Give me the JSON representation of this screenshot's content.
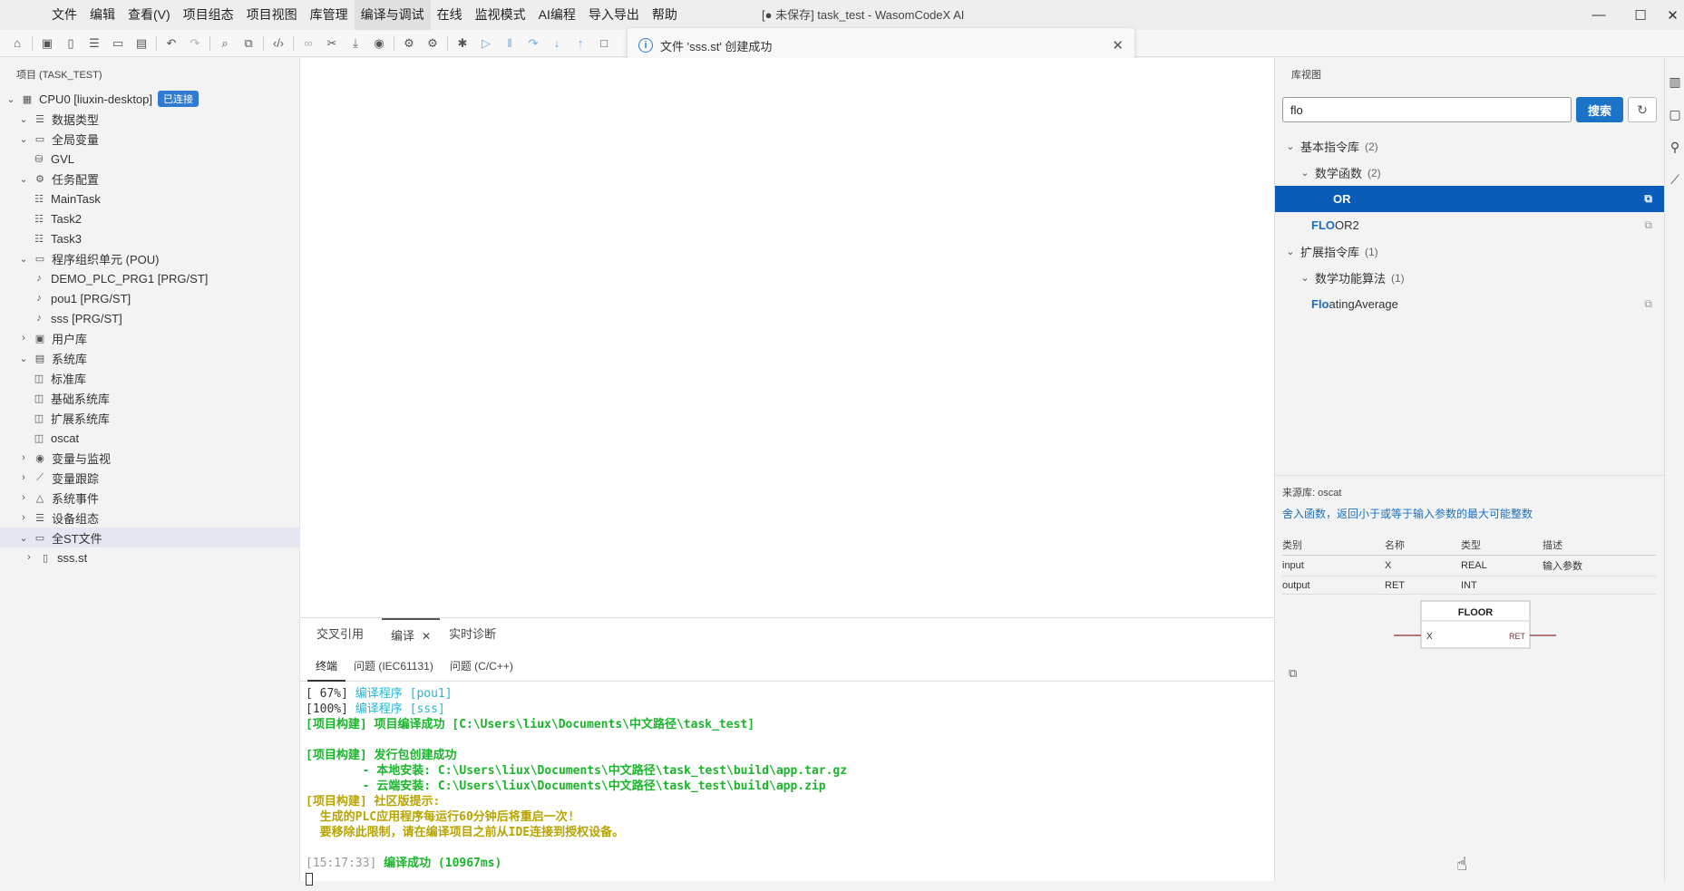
{
  "menu": [
    "文件",
    "编辑",
    "查看(V)",
    "项目组态",
    "项目视图",
    "库管理",
    "编译与调试",
    "在线",
    "监视模式",
    "AI编程",
    "导入导出",
    "帮助"
  ],
  "window_title": "[● 未保存] task_test - WasomCodeX AI",
  "toast": {
    "message": "文件 'sss.st' 创建成功"
  },
  "project_panel": {
    "title": "项目 (TASK_TEST)",
    "cpu": {
      "label": "CPU0 [liuxin-desktop]",
      "badge": "已连接"
    },
    "items": [
      {
        "label": "数据类型"
      },
      {
        "label": "全局变量"
      },
      {
        "label": "GVL"
      },
      {
        "label": "任务配置"
      },
      {
        "label": "MainTask"
      },
      {
        "label": "Task2"
      },
      {
        "label": "Task3"
      },
      {
        "label": "程序组织单元 (POU)"
      },
      {
        "label": "DEMO_PLC_PRG1 [PRG/ST]"
      },
      {
        "label": "pou1 [PRG/ST]"
      },
      {
        "label": "sss [PRG/ST]"
      },
      {
        "label": "用户库"
      },
      {
        "label": "系统库"
      },
      {
        "label": "标准库"
      },
      {
        "label": "基础系统库"
      },
      {
        "label": "扩展系统库"
      },
      {
        "label": "oscat"
      },
      {
        "label": "变量与监视"
      },
      {
        "label": "变量跟踪"
      },
      {
        "label": "系统事件"
      },
      {
        "label": "设备组态"
      },
      {
        "label": "全ST文件"
      },
      {
        "label": "sss.st"
      }
    ]
  },
  "bottom_panel": {
    "tabs": [
      "交叉引用",
      "编译",
      "实时诊断"
    ],
    "subtabs": [
      "终端",
      "问题 (IEC61131)",
      "问题 (C/C++)"
    ],
    "terminal": {
      "l1a": "[ 67%] ",
      "l1b": "编译程序 [pou1]",
      "l2a": "[100%] ",
      "l2b": "编译程序 [sss]",
      "l3": "[项目构建] 项目编译成功 [C:\\Users\\liux\\Documents\\中文路径\\task_test]",
      "l5": "[项目构建] 发行包创建成功",
      "l6": "        - 本地安装: C:\\Users\\liux\\Documents\\中文路径\\task_test\\build\\app.tar.gz",
      "l7": "        - 云端安装: C:\\Users\\liux\\Documents\\中文路径\\task_test\\build\\app.zip",
      "l8": "[项目构建] 社区版提示:",
      "l9": "  生成的PLC应用程序每运行60分钟后将重启一次!",
      "l10": "  要移除此限制，请在编译项目之前从IDE连接到授权设备。",
      "l12a": "[15:17:33] ",
      "l12b": "编译成功 (10967ms)"
    }
  },
  "library_view": {
    "title": "库视图",
    "search_value": "flo",
    "search_button": "搜索",
    "tree": {
      "basic": {
        "label": "基本指令库",
        "count": "(2)"
      },
      "math": {
        "label": "数学函数",
        "count": "(2)"
      },
      "item1": {
        "rest": "OR"
      },
      "item2": {
        "hl": "FLO",
        "rest": "OR2"
      },
      "ext": {
        "label": "扩展指令库",
        "count": "(1)"
      },
      "mathalg": {
        "label": "数学功能算法",
        "count": "(1)"
      },
      "item3": {
        "hl": "Flo",
        "rest": "atingAverage"
      }
    },
    "detail": {
      "source": "来源库: oscat",
      "description": "舍入函数，返回小于或等于输入参数的最大可能整数",
      "headers": [
        "类别",
        "名称",
        "类型",
        "描述"
      ],
      "rows": [
        [
          "input",
          "X",
          "REAL",
          "输入参数"
        ],
        [
          "output",
          "RET",
          "INT",
          ""
        ]
      ],
      "block": {
        "name": "FLOOR",
        "in": "X",
        "out": "RET"
      }
    }
  },
  "colors": {
    "accent": "#1a73c7",
    "selected": "#0b5cb8",
    "terminal_green": "#1ab52b",
    "terminal_cyan": "#1fb7d6",
    "terminal_yellow": "#b8a400"
  }
}
